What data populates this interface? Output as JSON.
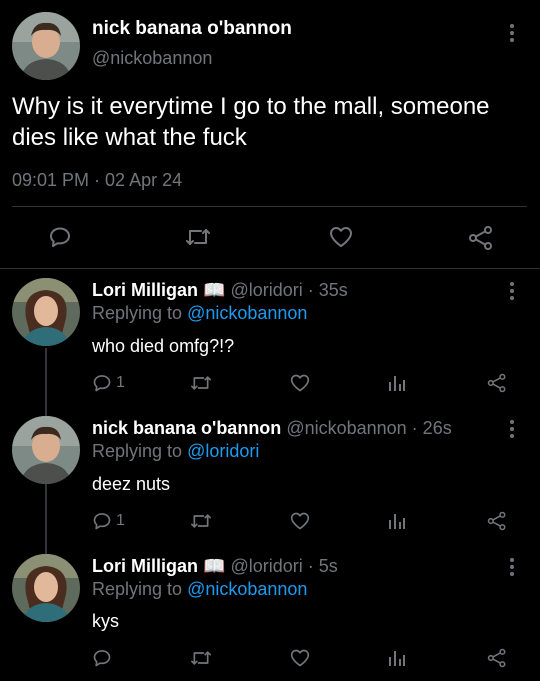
{
  "main_tweet": {
    "author_name": "nick banana o'bannon",
    "author_handle": "@nickobannon",
    "text": "Why is it everytime I go to the mall, someone dies like what the fuck",
    "timestamp": "09:01 PM · 02 Apr 24"
  },
  "replies": [
    {
      "author_name": "Lori Milligan",
      "emoji": "📖",
      "meta": "@loridori · 35s",
      "replying_prefix": "Replying to",
      "replying_handle": "@nickobannon",
      "text": "who died omfg?!?",
      "reply_count": "1"
    },
    {
      "author_name": "nick banana o'bannon",
      "meta": "@nickobannon · 26s",
      "replying_prefix": "Replying to",
      "replying_handle": "@loridori",
      "text": "deez nuts",
      "reply_count": "1"
    },
    {
      "author_name": "Lori Milligan",
      "emoji": "📖",
      "meta": "@loridori · 5s",
      "replying_prefix": "Replying to",
      "replying_handle": "@nickobannon",
      "text": "kys",
      "reply_count": ""
    }
  ],
  "colors": {
    "background": "#000000",
    "text": "#e7e9ea",
    "muted": "#71767b",
    "link": "#1d9bf0",
    "divider": "#2f3336"
  }
}
